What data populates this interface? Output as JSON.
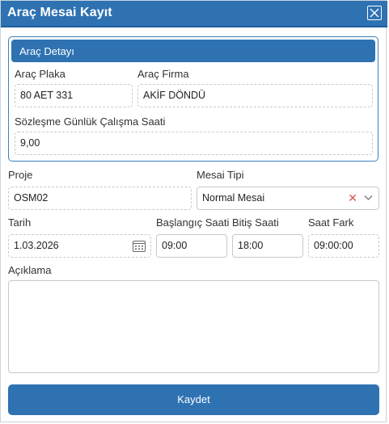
{
  "window": {
    "title": "Araç Mesai Kayıt",
    "close_icon": "close-icon"
  },
  "vehicle_details": {
    "title": "Araç Detayı",
    "plate_label": "Araç Plaka",
    "plate_value": "80 AET 331",
    "company_label": "Araç Firma",
    "company_value": "AKİF DÖNDÜ",
    "contract_hours_label": "Sözleşme Günlük Çalışma Saati",
    "contract_hours_value": "9,00"
  },
  "form": {
    "project_label": "Proje",
    "project_value": "OSM02",
    "shift_type_label": "Mesai Tipi",
    "shift_type_value": "Normal Mesai",
    "date_label": "Tarih",
    "date_value": "1.03.2026",
    "start_label": "Başlangıç Saati",
    "start_value": "09:00",
    "end_label": "Bitiş Saati",
    "end_value": "18:00",
    "diff_label": "Saat Fark",
    "diff_value": "09:00:00",
    "description_label": "Açıklama",
    "description_value": ""
  },
  "actions": {
    "save_label": "Kaydet"
  },
  "colors": {
    "primary": "#2e72b2",
    "clear_icon": "#d9534f"
  }
}
